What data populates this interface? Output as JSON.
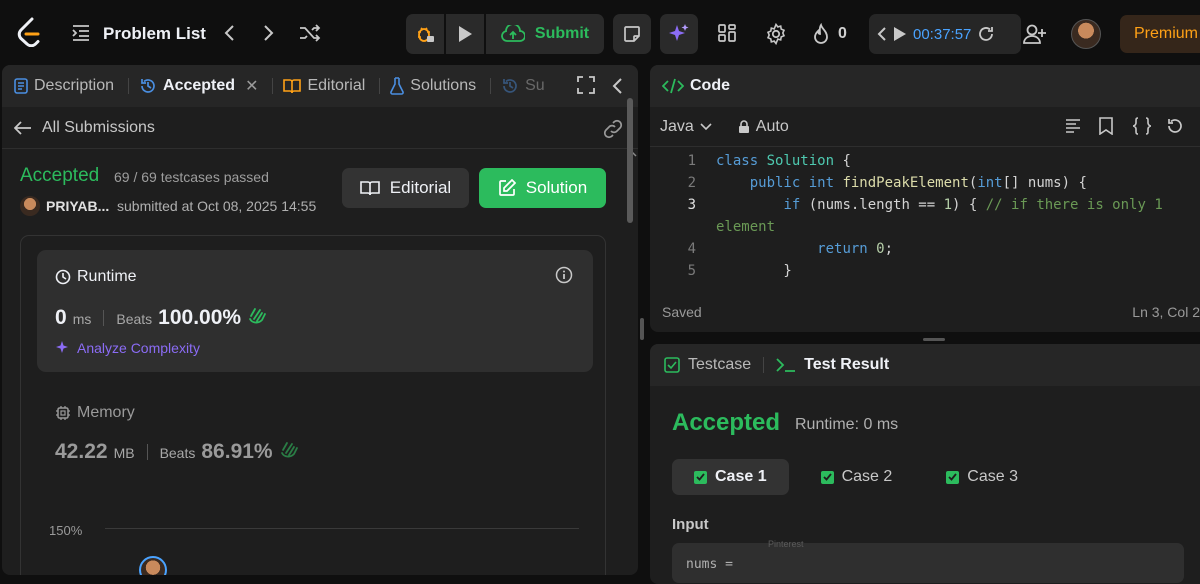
{
  "topbar": {
    "problem_list": "Problem List",
    "submit_label": "Submit",
    "streak_count": "0",
    "timer": "00:37:57",
    "premium_label": "Premium"
  },
  "left": {
    "tabs": [
      {
        "label": "Description"
      },
      {
        "label": "Accepted"
      },
      {
        "label": "Editorial"
      },
      {
        "label": "Solutions"
      },
      {
        "label": "Su"
      }
    ],
    "back_label": "All Submissions",
    "status": "Accepted",
    "testcases": "69 / 69 testcases passed",
    "username": "PRIYAB...",
    "submitted": "submitted at Oct 08, 2025 14:55",
    "editorial_btn": "Editorial",
    "solution_btn": "Solution",
    "runtime": {
      "title": "Runtime",
      "value": "0",
      "unit": "ms",
      "beats_label": "Beats",
      "beats_value": "100.00%",
      "analyze": "Analyze Complexity"
    },
    "memory": {
      "title": "Memory",
      "value": "42.22",
      "unit": "MB",
      "beats_label": "Beats",
      "beats_value": "86.91%"
    },
    "chart_tick": "150%"
  },
  "code": {
    "title": "Code",
    "language": "Java",
    "mode": "Auto",
    "lines": [
      {
        "n": "1",
        "segments": [
          [
            "kw",
            "class "
          ],
          [
            "ty",
            "Solution"
          ],
          [
            "pl",
            " {"
          ]
        ]
      },
      {
        "n": "2",
        "segments": [
          [
            "pl",
            "    "
          ],
          [
            "kw",
            "public int "
          ],
          [
            "fn",
            "findPeakElement"
          ],
          [
            "pl",
            "("
          ],
          [
            "kw",
            "int"
          ],
          [
            "pl",
            "[] nums) {"
          ]
        ]
      },
      {
        "n": "3",
        "segments": [
          [
            "pl",
            "        "
          ],
          [
            "kw",
            "if "
          ],
          [
            "pl",
            "(nums.length == "
          ],
          [
            "num",
            "1"
          ],
          [
            "pl",
            ") { "
          ],
          [
            "cm",
            "// if there is only 1"
          ]
        ]
      },
      {
        "n": "",
        "segments": [
          [
            "cm",
            "element"
          ]
        ]
      },
      {
        "n": "4",
        "segments": [
          [
            "pl",
            "            "
          ],
          [
            "kw",
            "return "
          ],
          [
            "num",
            "0"
          ],
          [
            "pl",
            ";"
          ]
        ]
      },
      {
        "n": "5",
        "segments": [
          [
            "pl",
            "        }"
          ]
        ]
      }
    ],
    "saved": "Saved",
    "position": "Ln 3, Col 2"
  },
  "result": {
    "tab_testcase": "Testcase",
    "tab_result": "Test Result",
    "status": "Accepted",
    "runtime": "Runtime: 0 ms",
    "cases": [
      "Case 1",
      "Case 2",
      "Case 3"
    ],
    "input_label": "Input",
    "input_preview": "nums =",
    "watermark": "Pinterest"
  },
  "colors": {
    "accent_green": "#2cbb5d",
    "brand_orange": "#ffa116",
    "timer_blue": "#4aa3ff",
    "ai_purple": "#8b6cf5"
  }
}
